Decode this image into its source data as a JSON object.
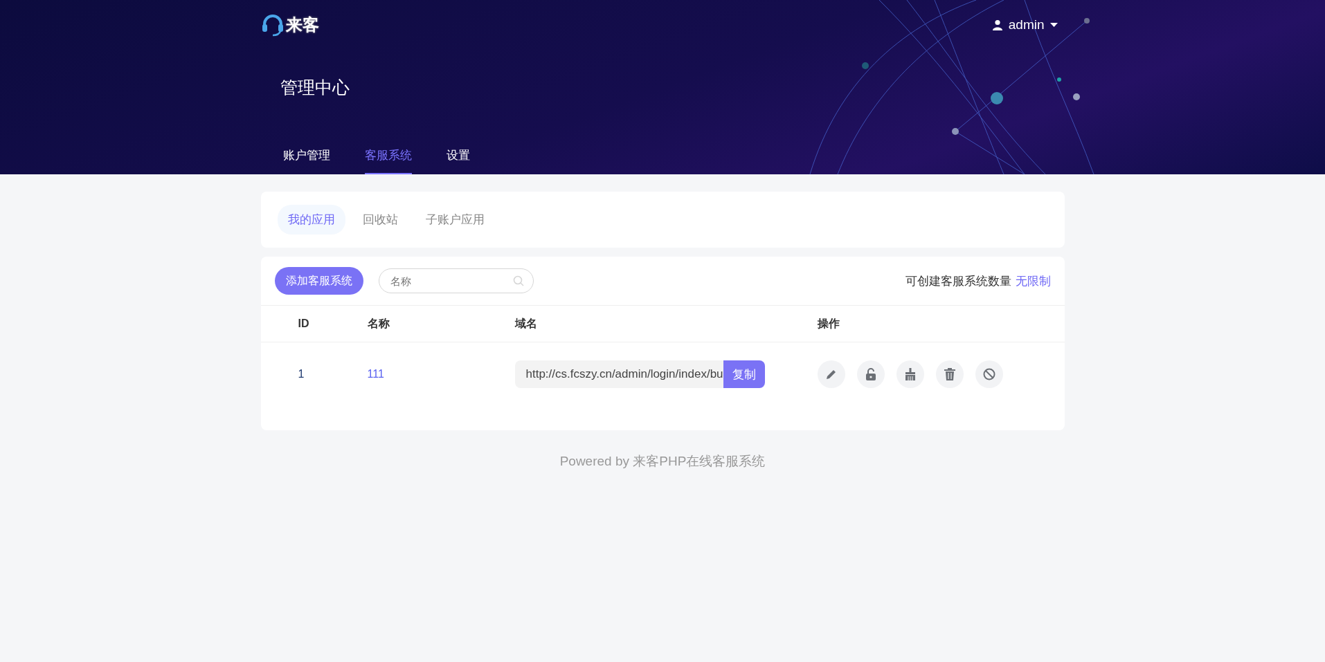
{
  "header": {
    "logo_text": "来客",
    "user": "admin",
    "title": "管理中心",
    "nav": [
      {
        "label": "账户管理",
        "selected": false
      },
      {
        "label": "客服系统",
        "selected": true
      },
      {
        "label": "设置",
        "selected": false
      }
    ]
  },
  "subtabs": [
    {
      "label": "我的应用",
      "selected": true
    },
    {
      "label": "回收站",
      "selected": false
    },
    {
      "label": "子账户应用",
      "selected": false
    }
  ],
  "toolbar": {
    "add_button": "添加客服系统",
    "search": {
      "placeholder": "名称"
    },
    "quota_label": "可创建客服系统数量",
    "quota_value": "无限制"
  },
  "table": {
    "columns": [
      "ID",
      "名称",
      "域名",
      "操作"
    ],
    "rows": [
      {
        "id": "1",
        "name": "111",
        "domain": "http://cs.fcszy.cn/admin/login/index/bu",
        "copy_button": "复制",
        "actions": [
          {
            "kind": "edit"
          },
          {
            "kind": "unlock"
          },
          {
            "kind": "clean"
          },
          {
            "kind": "delete"
          },
          {
            "kind": "disable"
          }
        ]
      }
    ]
  },
  "footer": "Powered by 来客PHP在线客服系统"
}
